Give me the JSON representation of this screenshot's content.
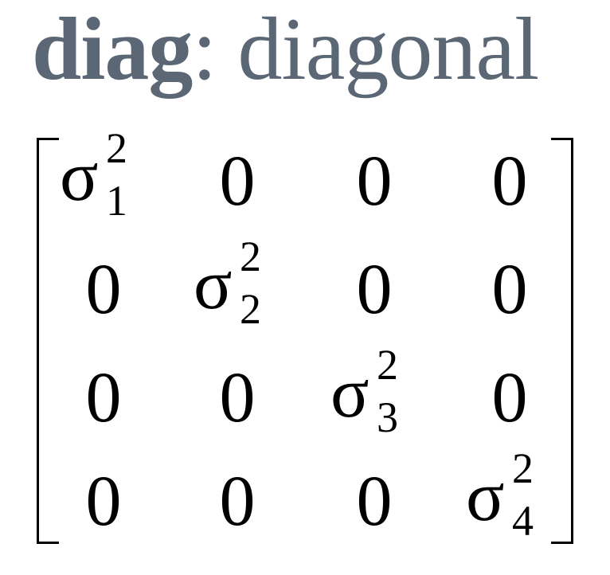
{
  "title": {
    "bold": "diag",
    "rest": ": diagonal"
  },
  "matrix": {
    "rows": [
      [
        {
          "type": "sigma",
          "base": "σ",
          "sub": "1",
          "sup": "2"
        },
        {
          "type": "num",
          "text": "0"
        },
        {
          "type": "num",
          "text": "0"
        },
        {
          "type": "num",
          "text": "0"
        }
      ],
      [
        {
          "type": "num",
          "text": "0"
        },
        {
          "type": "sigma",
          "base": "σ",
          "sub": "2",
          "sup": "2"
        },
        {
          "type": "num",
          "text": "0"
        },
        {
          "type": "num",
          "text": "0"
        }
      ],
      [
        {
          "type": "num",
          "text": "0"
        },
        {
          "type": "num",
          "text": "0"
        },
        {
          "type": "sigma",
          "base": "σ",
          "sub": "3",
          "sup": "2"
        },
        {
          "type": "num",
          "text": "0"
        }
      ],
      [
        {
          "type": "num",
          "text": "0"
        },
        {
          "type": "num",
          "text": "0"
        },
        {
          "type": "num",
          "text": "0"
        },
        {
          "type": "sigma",
          "base": "σ",
          "sub": "4",
          "sup": "2"
        }
      ]
    ]
  },
  "colors": {
    "title": "#5b6775",
    "matrix": "#000000"
  }
}
